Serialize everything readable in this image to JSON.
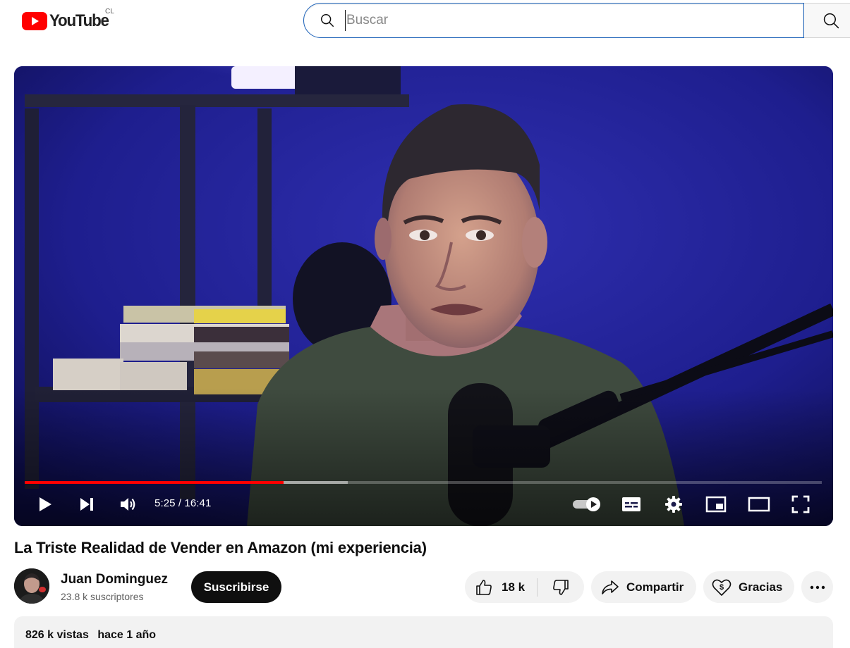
{
  "header": {
    "logo_text": "YouTube",
    "country_code": "CL",
    "search": {
      "placeholder": "Buscar",
      "value": ""
    },
    "colors": {
      "brand_red": "#ff0000",
      "search_focus": "#1c62b9"
    }
  },
  "player": {
    "current_time": "5:25",
    "duration": "16:41",
    "time_display": "5:25 / 16:41",
    "played_fraction": 0.325,
    "buffered_fraction": 0.405,
    "autoplay_on": true,
    "controls": {
      "left": [
        "play-icon",
        "next-icon",
        "volume-icon"
      ],
      "right": [
        "autoplay-toggle-icon",
        "subtitles-icon",
        "settings-icon",
        "miniplayer-icon",
        "theater-mode-icon",
        "fullscreen-icon"
      ]
    },
    "colors": {
      "progress_played": "#ff0000"
    }
  },
  "video": {
    "title": "La Triste Realidad de Vender en Amazon (mi experiencia)",
    "channel": {
      "name": "Juan Dominguez",
      "subscribers": "23.8 k suscriptores",
      "subscribe_label": "Suscribirse"
    },
    "actions": {
      "likes": "18 k",
      "share_label": "Compartir",
      "thanks_label": "Gracias"
    },
    "description": {
      "views": "826 k vistas",
      "date": "hace 1 año"
    }
  }
}
